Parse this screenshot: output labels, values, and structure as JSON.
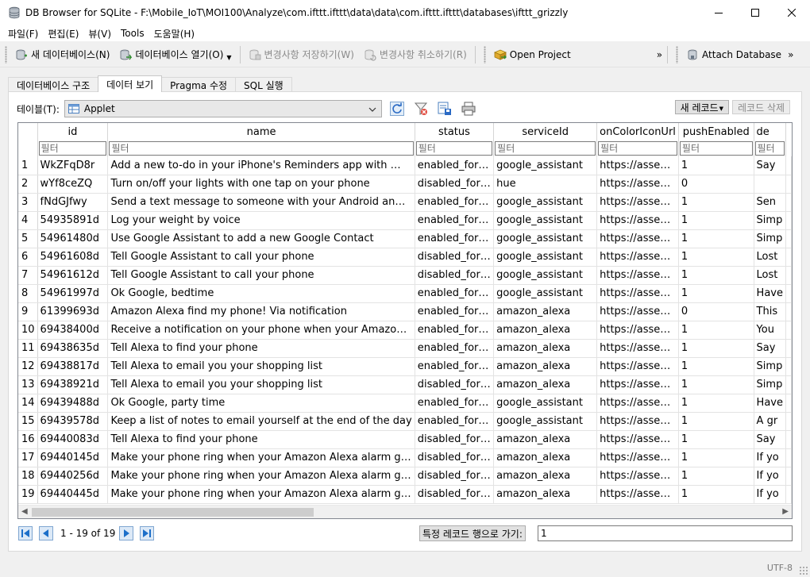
{
  "window": {
    "title": "DB Browser for SQLite - F:\\Mobile_IoT\\MOI100\\Analyze\\com.ifttt.ifttt\\data\\data\\com.ifttt.ifttt\\databases\\ifttt_grizzly"
  },
  "menu": [
    "파일(F)",
    "편집(E)",
    "뷰(V)",
    "Tools",
    "도움말(H)"
  ],
  "toolbar": {
    "new_db": "새 데이터베이스(N)",
    "open_db": "데이터베이스 열기(O)",
    "write_changes": "변경사항 저장하기(W)",
    "revert_changes": "변경사항 취소하기(R)",
    "open_project": "Open Project",
    "attach_db": "Attach Database",
    "more": "»"
  },
  "tabs": [
    "데이터베이스 구조",
    "데이터 보기",
    "Pragma 수정",
    "SQL 실행"
  ],
  "active_tab": 1,
  "browse": {
    "table_label": "테이블(T):",
    "table_name": "Applet",
    "new_record": "새 레코드",
    "delete_record": "레코드 삭제"
  },
  "grid": {
    "columns": [
      "id",
      "name",
      "status",
      "serviceId",
      "onColorIconUrl",
      "pushEnabled",
      "de"
    ],
    "filter_placeholder": "필터",
    "rows": [
      {
        "n": "1",
        "cells": [
          "WkZFqD8r",
          "Add a new to-do in your iPhone's Reminders app with …",
          "enabled_for…",
          "google_assistant",
          "https://asse…",
          "1",
          "Say"
        ]
      },
      {
        "n": "2",
        "cells": [
          "wYf8ceZQ",
          "Turn on/off your lights with one tap on your phone",
          "disabled_for…",
          "hue",
          "https://asse…",
          "0",
          ""
        ]
      },
      {
        "n": "3",
        "cells": [
          "fNdGJfwy",
          "Send a text message to someone with your Android an…",
          "enabled_for…",
          "google_assistant",
          "https://asse…",
          "1",
          "Sen"
        ]
      },
      {
        "n": "4",
        "cells": [
          "54935891d",
          "Log your weight by voice",
          "enabled_for…",
          "google_assistant",
          "https://asse…",
          "1",
          "Simp"
        ]
      },
      {
        "n": "5",
        "cells": [
          "54961480d",
          "Use Google Assistant to add a new Google Contact",
          "enabled_for…",
          "google_assistant",
          "https://asse…",
          "1",
          "Simp"
        ]
      },
      {
        "n": "6",
        "cells": [
          "54961608d",
          "Tell Google Assistant to call your phone",
          "disabled_for…",
          "google_assistant",
          "https://asse…",
          "1",
          "Lost"
        ]
      },
      {
        "n": "7",
        "cells": [
          "54961612d",
          "Tell Google Assistant to call your phone",
          "disabled_for…",
          "google_assistant",
          "https://asse…",
          "1",
          "Lost"
        ]
      },
      {
        "n": "8",
        "cells": [
          "54961997d",
          "Ok Google, bedtime",
          "enabled_for…",
          "google_assistant",
          "https://asse…",
          "1",
          "Have"
        ]
      },
      {
        "n": "9",
        "cells": [
          "61399693d",
          "Amazon Alexa find my phone! Via notification",
          "enabled_for…",
          "amazon_alexa",
          "https://asse…",
          "0",
          " This"
        ]
      },
      {
        "n": "10",
        "cells": [
          "69438400d",
          "Receive a notification on your phone when your Amazo…",
          "enabled_for…",
          "amazon_alexa",
          "https://asse…",
          "1",
          "You"
        ]
      },
      {
        "n": "11",
        "cells": [
          "69438635d",
          "Tell Alexa to find your phone",
          "enabled_for…",
          "amazon_alexa",
          "https://asse…",
          "1",
          "Say"
        ]
      },
      {
        "n": "12",
        "cells": [
          "69438817d",
          "Tell Alexa to email you your shopping list",
          "enabled_for…",
          "amazon_alexa",
          "https://asse…",
          "1",
          "Simp"
        ]
      },
      {
        "n": "13",
        "cells": [
          "69438921d",
          "Tell Alexa to email you your shopping list",
          "disabled_for…",
          "amazon_alexa",
          "https://asse…",
          "1",
          "Simp"
        ]
      },
      {
        "n": "14",
        "cells": [
          "69439488d",
          "Ok Google, party time",
          "enabled_for…",
          "google_assistant",
          "https://asse…",
          "1",
          "Have"
        ]
      },
      {
        "n": "15",
        "cells": [
          "69439578d",
          "Keep a list of notes to email yourself at the end of the day",
          "enabled_for…",
          "google_assistant",
          "https://asse…",
          "1",
          "A gr"
        ]
      },
      {
        "n": "16",
        "cells": [
          "69440083d",
          "Tell Alexa to find your phone",
          "disabled_for…",
          "amazon_alexa",
          "https://asse…",
          "1",
          "Say"
        ]
      },
      {
        "n": "17",
        "cells": [
          "69440145d",
          "Make your phone ring when your Amazon Alexa alarm g…",
          "disabled_for…",
          "amazon_alexa",
          "https://asse…",
          "1",
          "If yo"
        ]
      },
      {
        "n": "18",
        "cells": [
          "69440256d",
          "Make your phone ring when your Amazon Alexa alarm g…",
          "disabled_for…",
          "amazon_alexa",
          "https://asse…",
          "1",
          "If yo"
        ]
      },
      {
        "n": "19",
        "cells": [
          "69440445d",
          "Make your phone ring when your Amazon Alexa alarm g…",
          "disabled_for…",
          "amazon_alexa",
          "https://asse…",
          "1",
          "If yo"
        ]
      }
    ]
  },
  "navigation": {
    "record_count": "1 - 19 of 19",
    "goto_label": "특정 레코드 행으로 가기:",
    "goto_value": "1"
  },
  "statusbar": {
    "encoding": "UTF-8"
  },
  "colors": {
    "accent_blue": "#1c6fc9",
    "border": "#828790",
    "disabled_text": "#8a8a8a"
  },
  "icons": {
    "app": "database-icon",
    "new_db": "new-database-icon",
    "open_db": "open-database-icon",
    "write": "write-changes-icon",
    "revert": "revert-changes-icon",
    "project": "open-project-icon",
    "attach": "attach-database-icon",
    "table": "table-icon",
    "refresh": "refresh-icon",
    "clear_filters": "clear-filters-icon",
    "save_table": "save-table-icon",
    "print": "print-icon"
  }
}
